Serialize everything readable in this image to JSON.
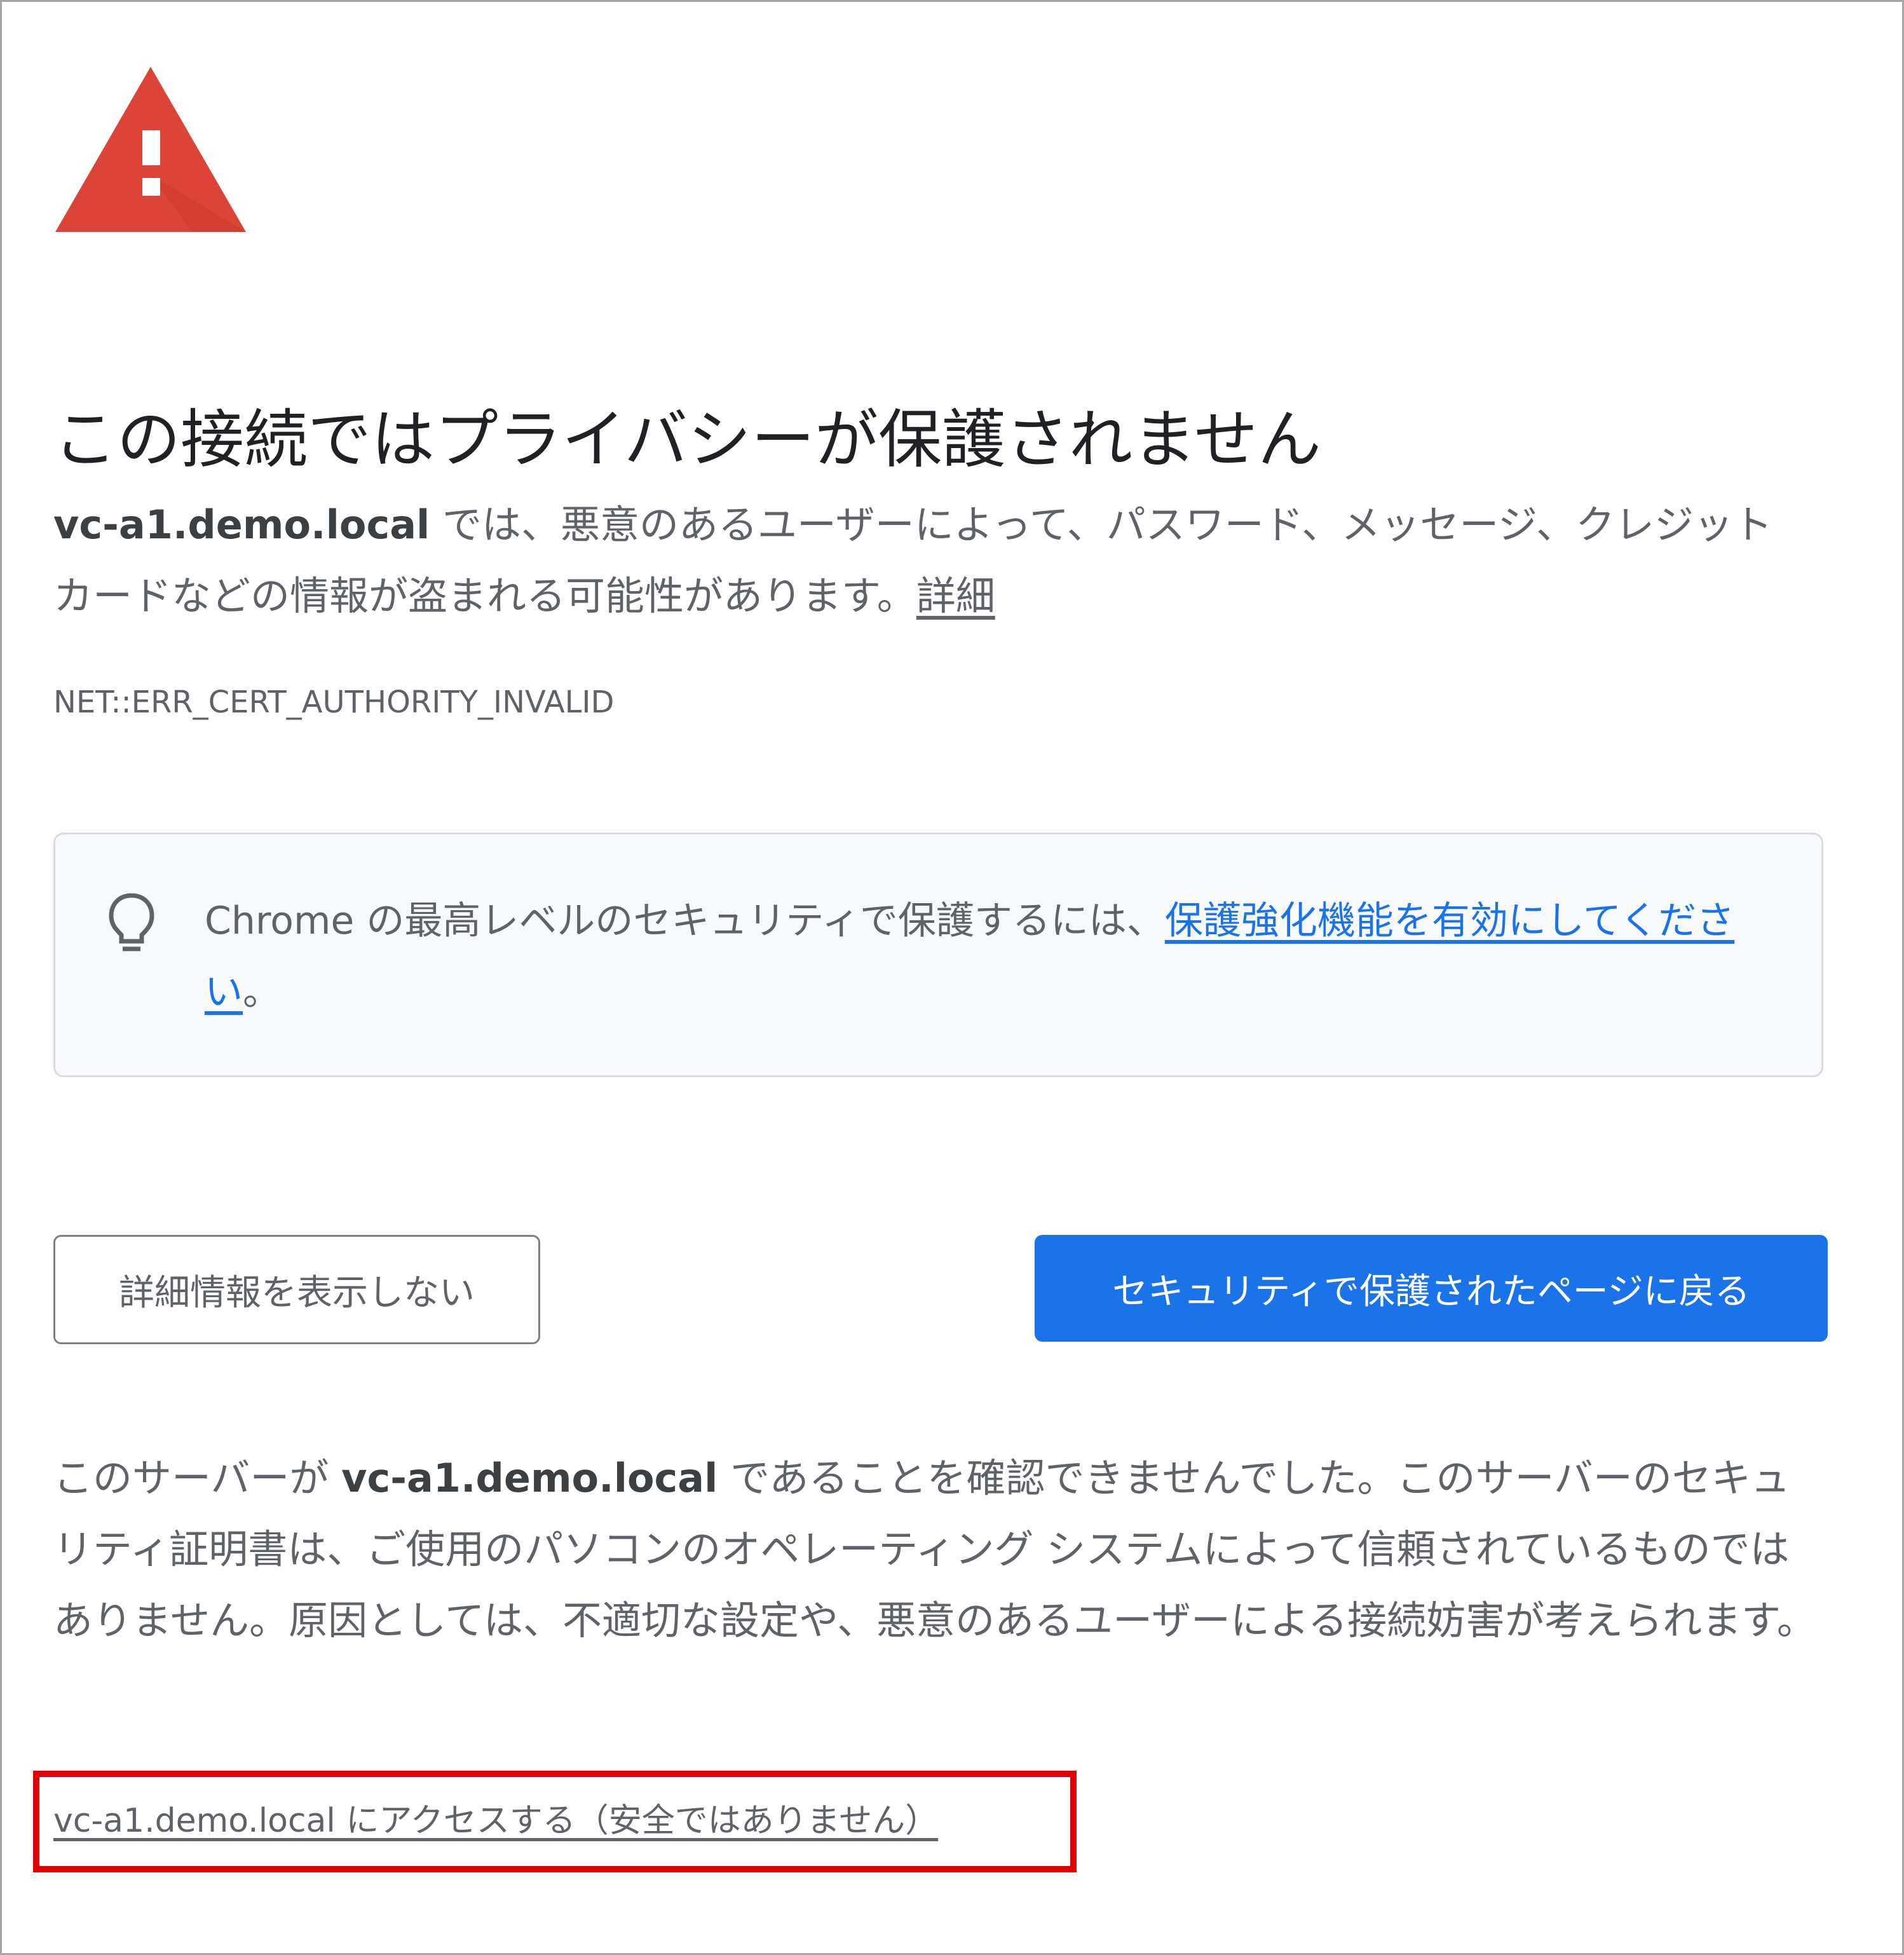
{
  "icons": {
    "warning": "warning-triangle-icon",
    "bulb": "lightbulb-icon",
    "warning_color": "#db4437",
    "link_color": "#1a73e8",
    "primary_button_color": "#1a73e8",
    "highlight_color": "#e00000"
  },
  "title": "この接続ではプライバシーが保護されません",
  "description": {
    "host": "vc-a1.demo.local",
    "text": " では、悪意のあるユーザーによって、パスワード、メッセージ、クレジット カードなどの情報が盗まれる可能性があります。",
    "details_link": "詳細"
  },
  "error_code": "NET::ERR_CERT_AUTHORITY_INVALID",
  "tip": {
    "text_before": "Chrome の最高レベルのセキュリティで保護するには、",
    "link": "保護強化機能を有効にしてください",
    "text_after": "。"
  },
  "buttons": {
    "hide_details": "詳細情報を表示しない",
    "back_to_safety": "セキュリティで保護されたページに戻る"
  },
  "details": {
    "text_before": "このサーバーが ",
    "host": "vc-a1.demo.local",
    "text_after": " であることを確認できませんでした。このサーバーのセキュリティ証明書は、ご使用のパソコンのオペレーティング システムによって信頼されているものではありません。原因としては、不適切な設定や、悪意のあるユーザーによる接続妨害が考えられます。"
  },
  "proceed_link": "vc-a1.demo.local にアクセスする（安全ではありません）"
}
